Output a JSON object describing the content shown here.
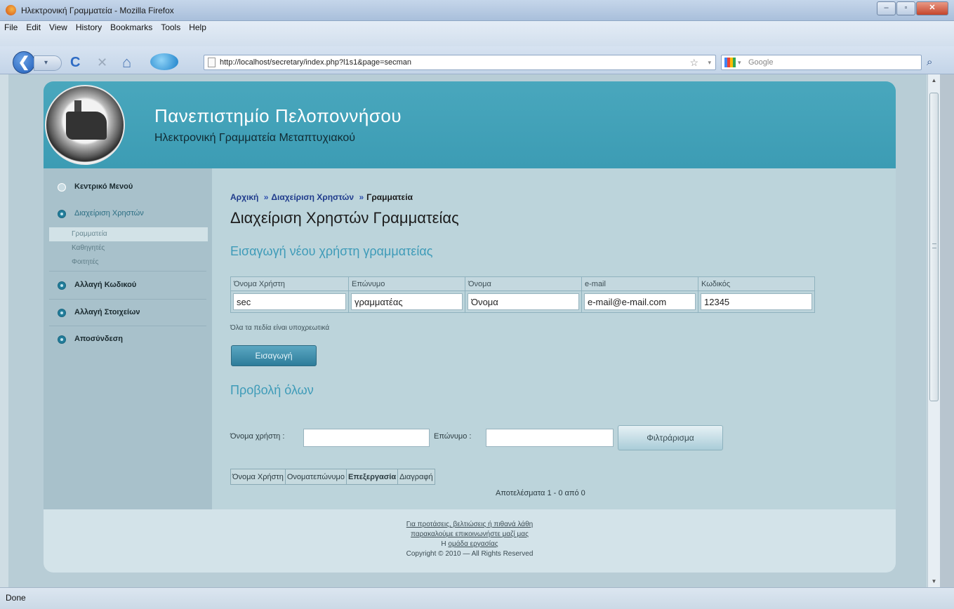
{
  "window": {
    "title": "Ηλεκτρονική Γραμματεία - Mozilla Firefox",
    "minimize": "–",
    "maximize": "▫",
    "close": "✕"
  },
  "menubar": [
    "File",
    "Edit",
    "View",
    "History",
    "Bookmarks",
    "Tools",
    "Help"
  ],
  "navigation": {
    "back": "❮",
    "forward": "▾",
    "reload": "C",
    "stop": "✕",
    "home": "⌂",
    "url": "http://localhost/secretary/index.php?l1s1&page=secman",
    "search_placeholder": "Google",
    "search_go": "⌕",
    "bookmark_star": "☆",
    "dropdown": "▾"
  },
  "site": {
    "title": "Πανεπιστημίο Πελοποννήσου",
    "subtitle": "Ηλεκτρονική Γραμματεία Μεταπτυχιακού"
  },
  "sidebar": {
    "items": [
      {
        "label": "Κεντρικό Μενού"
      },
      {
        "label": "Διαχείριση Χρηστών"
      },
      {
        "label": "Αλλαγή Κωδικού"
      },
      {
        "label": "Αλλαγή Στοιχείων"
      },
      {
        "label": "Αποσύνδεση"
      }
    ],
    "subitems": [
      {
        "label": "Γραμματεία"
      },
      {
        "label": "Καθηγητές"
      },
      {
        "label": "Φοιτητές"
      }
    ]
  },
  "breadcrumb": {
    "home": "Αρχική",
    "users": "Διαχείριση Χρηστών",
    "current": "Γραμματεία",
    "separator": "»"
  },
  "page_heading": "Διαχείριση Χρηστών Γραμματείας",
  "insert_section": {
    "heading": "Εισαγωγή νέου χρήστη γραμματείας",
    "columns": [
      "Όνομα Χρήστη",
      "Επώνυμο",
      "Όνομα",
      "e-mail",
      "Κωδικός"
    ],
    "values": [
      "sec",
      "γραμματέας",
      "Όνομα",
      "e-mail@e-mail.com",
      "12345"
    ],
    "required_note": "Όλα τα πεδία είναι υποχρεωτικά",
    "insert_button": "Εισαγωγή"
  },
  "view_section": {
    "heading": "Προβολή όλων",
    "filter_username_label": "Όνομα χρήστη :",
    "filter_surname_label": "Επώνυμο :",
    "filter_username_value": "",
    "filter_surname_value": "",
    "filter_button": "Φιλτράρισμα",
    "results_columns": [
      "Όνομα Χρήστη",
      "Ονοματεπώνυμο",
      "Επεξεργασία",
      "Διαγραφή"
    ],
    "results_count": "Αποτελέσματα 1 - 0 από 0"
  },
  "footer": {
    "line1": "Για προτάσεις, βελτιώσεις ή πιθανά λάθη",
    "line2": "παρακαλούμε επικοινωνήστε μαζί μας",
    "line3_prefix": "Η ",
    "line3_link": "ομάδα εργασίας",
    "copyright": "Copyright © 2010 — All Rights Reserved"
  },
  "status": "Done",
  "colors": {
    "header": "#49a7bd",
    "sidebar": "#a8c1cb",
    "content": "#bcd4db",
    "accent_heading": "#3e9bb8",
    "button": "#2d7c9a"
  }
}
